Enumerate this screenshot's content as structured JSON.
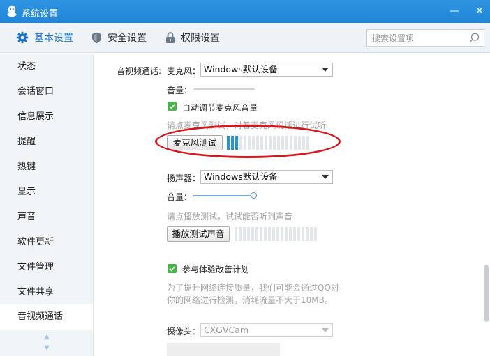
{
  "window": {
    "title": "系统设置",
    "minimize_label": "—",
    "close_label": "✕"
  },
  "tabs": [
    {
      "label": "基本设置",
      "icon": "gear-icon",
      "active": true
    },
    {
      "label": "安全设置",
      "icon": "shield-icon",
      "active": false
    },
    {
      "label": "权限设置",
      "icon": "lock-icon",
      "active": false
    }
  ],
  "search": {
    "placeholder": "搜索设置项",
    "value": ""
  },
  "sidebar": {
    "items": [
      {
        "label": "状态"
      },
      {
        "label": "会话窗口"
      },
      {
        "label": "信息展示"
      },
      {
        "label": "提醒"
      },
      {
        "label": "热键"
      },
      {
        "label": "显示"
      },
      {
        "label": "声音"
      },
      {
        "label": "软件更新"
      },
      {
        "label": "文件管理"
      },
      {
        "label": "文件共享"
      },
      {
        "label": "音视频通话"
      }
    ],
    "active_index": 10
  },
  "av": {
    "section_label": "音视频通话:",
    "mic": {
      "label": "麦克风：",
      "device": "Windows默认设备",
      "volume_label": "音量：",
      "auto_adjust_label": "自动调节麦克风音量",
      "auto_adjust_checked": true,
      "hint": "请点麦克风测试，对着麦克风说话进行试听",
      "test_button": "麦克风测试",
      "level_segments_total": 20,
      "level_segments_on": 3
    },
    "speaker": {
      "label": "扬声器：",
      "device": "Windows默认设备",
      "volume_label": "音量：",
      "volume_level": 0.98,
      "hint": "请点播放测试，试试能否听到声音",
      "test_button": "播放测试声音",
      "level_segments_total": 20,
      "level_segments_on": 0
    },
    "experience": {
      "label": "参与体验改善计划",
      "checked": true,
      "desc_line1": "为了提升网络连接质量，我们可能会通过QQ对",
      "desc_line2": "你的网络进行检测。消耗流量不大于10MB。"
    },
    "camera": {
      "label": "摄像头：",
      "device": "CXGVCam"
    }
  },
  "colors": {
    "titlebar": "#1f86d8",
    "active_tab": "#1a73c8",
    "checkbox": "#48b548",
    "meter_on": "#1f96d8",
    "annotation": "#d8171d"
  }
}
